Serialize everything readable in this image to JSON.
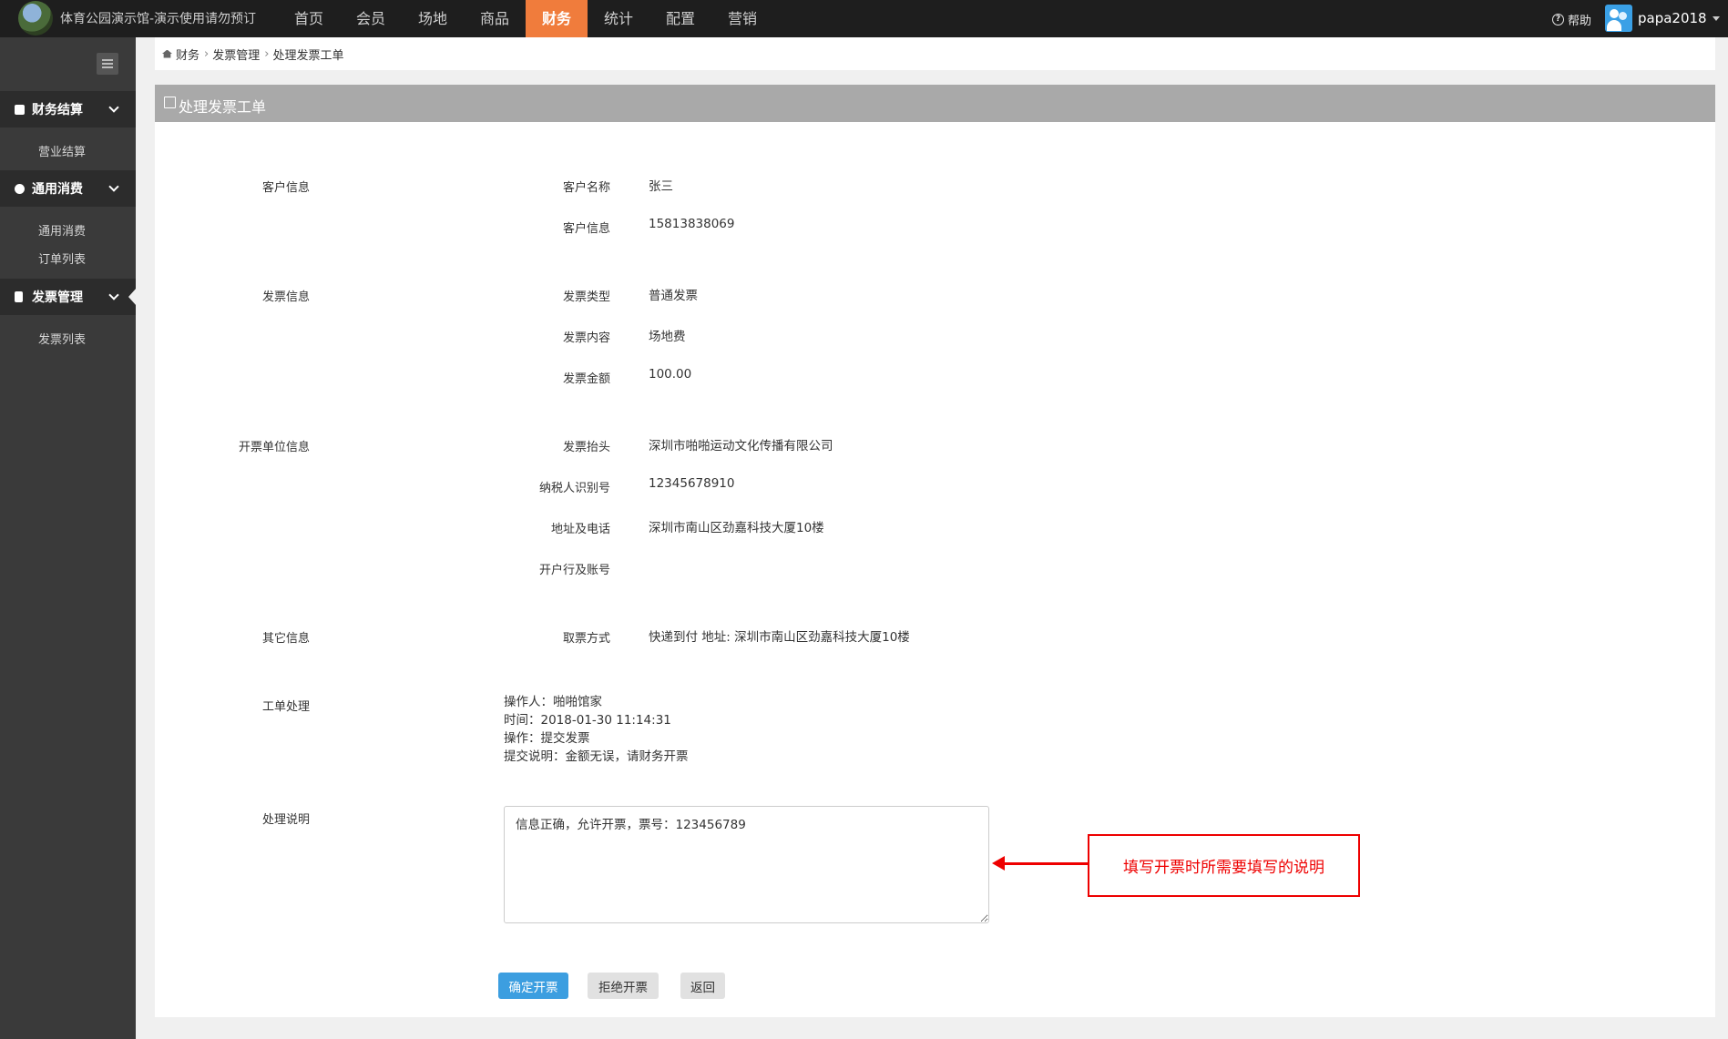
{
  "app": {
    "site_title": "体育公园演示馆-演示使用请勿预订",
    "nav": [
      "首页",
      "会员",
      "场地",
      "商品",
      "财务",
      "统计",
      "配置",
      "营销"
    ],
    "active_nav": "财务",
    "help_label": "帮助",
    "username": "papa2018"
  },
  "sidebar": {
    "groups": [
      {
        "label": "财务结算",
        "icon": "paypal-icon",
        "items": [
          "营业结算"
        ]
      },
      {
        "label": "通用消费",
        "icon": "globe-icon",
        "items": [
          "通用消费",
          "订单列表"
        ]
      },
      {
        "label": "发票管理",
        "icon": "invoice-icon",
        "items": [
          "发票列表"
        ]
      }
    ]
  },
  "breadcrumb": [
    "财务",
    "发票管理",
    "处理发票工单"
  ],
  "panel": {
    "title": "处理发票工单",
    "sections": {
      "customer": "客户信息",
      "invoice": "发票信息",
      "issuer": "开票单位信息",
      "other": "其它信息",
      "workorder": "工单处理",
      "remark": "处理说明"
    },
    "fields": {
      "customer_name_label": "客户名称",
      "customer_name": "张三",
      "customer_info_label": "客户信息",
      "customer_info": "15813838069",
      "invoice_type_label": "发票类型",
      "invoice_type": "普通发票",
      "invoice_content_label": "发票内容",
      "invoice_content": "场地费",
      "invoice_amount_label": "发票金额",
      "invoice_amount": "100.00",
      "title_label": "发票抬头",
      "title_value": "深圳市啪啪运动文化传播有限公司",
      "taxid_label": "纳税人识别号",
      "taxid_value": "12345678910",
      "address_label": "地址及电话",
      "address_value": "深圳市南山区劲嘉科技大厦10楼",
      "bank_label": "开户行及账号",
      "bank_value": "",
      "pickup_label": "取票方式",
      "pickup_value": "快递到付 地址: 深圳市南山区劲嘉科技大厦10楼"
    },
    "log": [
      "操作人：啪啪馆家",
      "时间：2018-01-30 11:14:31",
      "操作：提交发票",
      "提交说明：金额无误，请财务开票"
    ],
    "remark_value": "信息正确，允许开票，票号：123456789",
    "annotation": "填写开票时所需要填写的说明",
    "buttons": {
      "confirm": "确定开票",
      "reject": "拒绝开票",
      "back": "返回"
    }
  }
}
